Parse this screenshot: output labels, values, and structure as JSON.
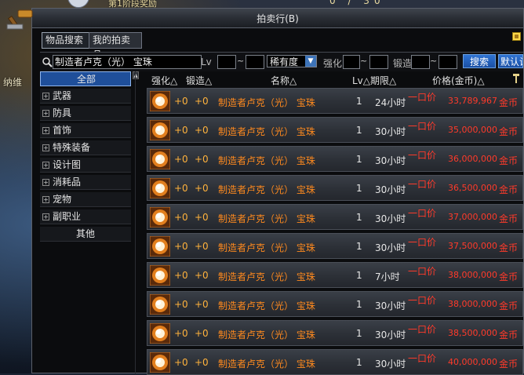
{
  "background": {
    "top_text": "第1阶段奖励",
    "coord": "0 / 30",
    "npc_name": "纳维"
  },
  "window": {
    "title": "拍卖行(B)",
    "tabs": [
      "物品搜索",
      "我的拍卖品"
    ]
  },
  "search": {
    "item_name": "制造者卢克（光） 宝珠",
    "lv_label": "Lv",
    "rarity_selected": "稀有度",
    "enhance_label": "强化",
    "forge_label": "锻造",
    "search_button": "搜索",
    "default_button": "默认设"
  },
  "sidebar": {
    "categories": [
      {
        "label": "全部",
        "expandable": false,
        "selected": true
      },
      {
        "label": "武器",
        "expandable": true
      },
      {
        "label": "防具",
        "expandable": true
      },
      {
        "label": "首饰",
        "expandable": true
      },
      {
        "label": "特殊装备",
        "expandable": true
      },
      {
        "label": "设计图",
        "expandable": true
      },
      {
        "label": "消耗品",
        "expandable": true
      },
      {
        "label": "宠物",
        "expandable": true
      },
      {
        "label": "副职业",
        "expandable": true
      },
      {
        "label": "其他",
        "expandable": false
      }
    ]
  },
  "table": {
    "headers": {
      "enhance": "强化△",
      "forge": "锻造△",
      "name": "名称△",
      "lv_time": "Lv△期限△",
      "price": "价格(金币)△"
    },
    "rows": [
      {
        "enhance": "+0",
        "forge": "+0",
        "name": "制造者卢克（光） 宝珠",
        "lv": "1",
        "time": "24小时",
        "buy": "一口价",
        "price": "33,789,967",
        "currency": "金币"
      },
      {
        "enhance": "+0",
        "forge": "+0",
        "name": "制造者卢克（光） 宝珠",
        "lv": "1",
        "time": "30小时",
        "buy": "一口价",
        "price": "35,000,000",
        "currency": "金币"
      },
      {
        "enhance": "+0",
        "forge": "+0",
        "name": "制造者卢克（光） 宝珠",
        "lv": "1",
        "time": "30小时",
        "buy": "一口价",
        "price": "36,000,000",
        "currency": "金币"
      },
      {
        "enhance": "+0",
        "forge": "+0",
        "name": "制造者卢克（光） 宝珠",
        "lv": "1",
        "time": "30小时",
        "buy": "一口价",
        "price": "36,500,000",
        "currency": "金币"
      },
      {
        "enhance": "+0",
        "forge": "+0",
        "name": "制造者卢克（光） 宝珠",
        "lv": "1",
        "time": "30小时",
        "buy": "一口价",
        "price": "37,000,000",
        "currency": "金币"
      },
      {
        "enhance": "+0",
        "forge": "+0",
        "name": "制造者卢克（光） 宝珠",
        "lv": "1",
        "time": "30小时",
        "buy": "一口价",
        "price": "37,500,000",
        "currency": "金币"
      },
      {
        "enhance": "+0",
        "forge": "+0",
        "name": "制造者卢克（光） 宝珠",
        "lv": "1",
        "time": "7小时",
        "buy": "一口价",
        "price": "38,000,000",
        "currency": "金币"
      },
      {
        "enhance": "+0",
        "forge": "+0",
        "name": "制造者卢克（光） 宝珠",
        "lv": "1",
        "time": "30小时",
        "buy": "一口价",
        "price": "38,000,000",
        "currency": "金币"
      },
      {
        "enhance": "+0",
        "forge": "+0",
        "name": "制造者卢克（光） 宝珠",
        "lv": "1",
        "time": "30小时",
        "buy": "一口价",
        "price": "38,500,000",
        "currency": "金币"
      },
      {
        "enhance": "+0",
        "forge": "+0",
        "name": "制造者卢克（光） 宝珠",
        "lv": "1",
        "time": "30小时",
        "buy": "一口价",
        "price": "40,000,000",
        "currency": "金币"
      }
    ]
  },
  "icons": {
    "item": "orb-item-icon",
    "search": "magnifier-icon",
    "auction": "hammer-icon",
    "pin": "pin-icon"
  },
  "colors": {
    "price": "#ff3a2a",
    "item_name": "#ff8a1e",
    "selected": "#1f4f9a"
  }
}
